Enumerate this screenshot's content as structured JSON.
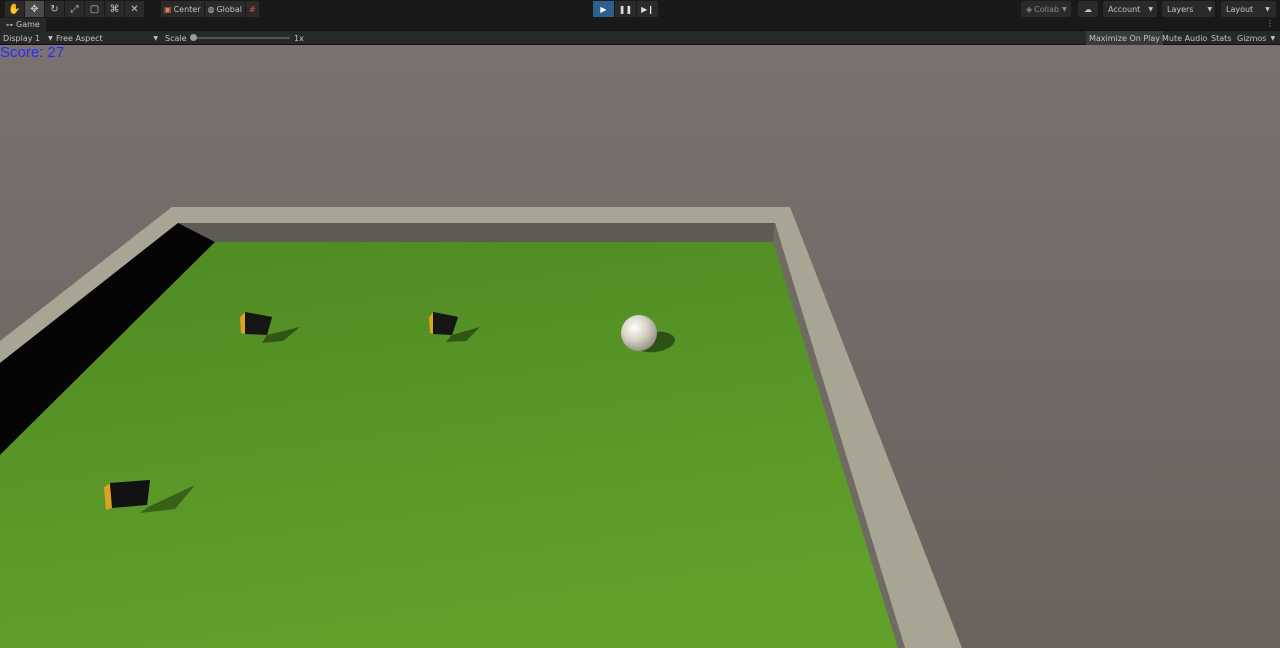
{
  "toolbar": {
    "tools": [
      {
        "name": "hand-tool-icon",
        "glyph": "✋"
      },
      {
        "name": "move-tool-icon",
        "glyph": "✥"
      },
      {
        "name": "rotate-tool-icon",
        "glyph": "↻"
      },
      {
        "name": "scale-tool-icon",
        "glyph": "⤢"
      },
      {
        "name": "rect-tool-icon",
        "glyph": "▢"
      },
      {
        "name": "transform-tool-icon",
        "glyph": "⌘"
      },
      {
        "name": "custom-tool-icon",
        "glyph": "✕"
      }
    ],
    "pivot_label": "Center",
    "space_label": "Global",
    "collab_label": "Collab",
    "account_label": "Account",
    "layers_label": "Layers",
    "layout_label": "Layout"
  },
  "tab": {
    "label": "Game"
  },
  "options": {
    "display": "Display 1",
    "aspect": "Free Aspect",
    "scale_label": "Scale",
    "scale_value": "1x",
    "maximize_on_play": "Maximize On Play",
    "mute_audio": "Mute Audio",
    "stats": "Stats",
    "gizmos": "Gizmos"
  },
  "game": {
    "score_text": "Score: 27"
  },
  "colors": {
    "floor": "#5a9428",
    "wall_top": "#a8a595",
    "background": "#6e6560",
    "score": "#2a2aff",
    "cube_face": "#e0a020"
  }
}
